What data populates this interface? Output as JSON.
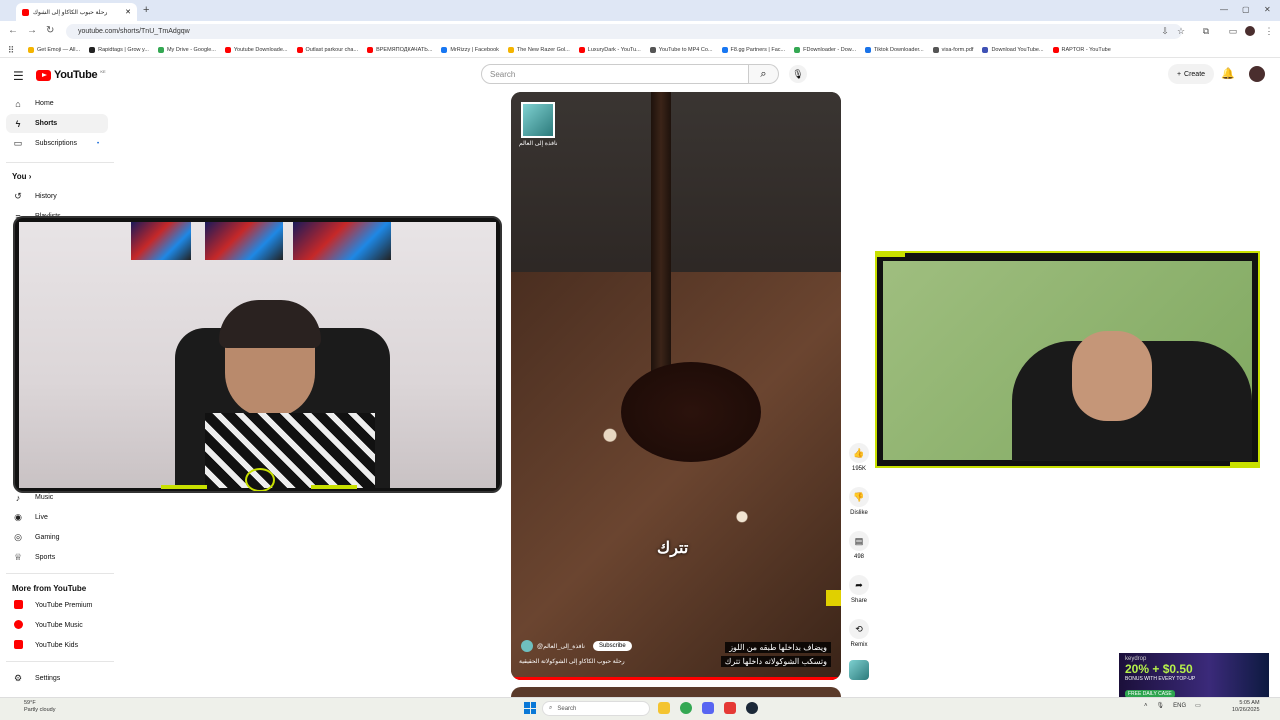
{
  "browser": {
    "tab_title": "رحلة حبوب الكاكاو إلى الشوك",
    "url": "youtube.com/shorts/TnU_TmAdgqw",
    "bookmarks": [
      {
        "label": "Get Emoji — All...",
        "color": "#f4b400"
      },
      {
        "label": "Rapidtags | Grow y...",
        "color": "#222222"
      },
      {
        "label": "My Drive - Google...",
        "color": "#34a853"
      },
      {
        "label": "Youtube Downloade...",
        "color": "#ff0000"
      },
      {
        "label": "Outlast parkour cha...",
        "color": "#ff0000"
      },
      {
        "label": "ВРЕМЯПОДКАЧАТЬ...",
        "color": "#ff0000"
      },
      {
        "label": "MrRizzy | Facebook",
        "color": "#1877f2"
      },
      {
        "label": "The New Razer Gol...",
        "color": "#f4b400"
      },
      {
        "label": "LuxuryDark - YouTu...",
        "color": "#ff0000"
      },
      {
        "label": "YouTube to MP4 Co...",
        "color": "#555555"
      },
      {
        "label": "F8.gg Partners | Fac...",
        "color": "#1877f2"
      },
      {
        "label": "FDownloader - Dow...",
        "color": "#34a853"
      },
      {
        "label": "Tiktok Downloader...",
        "color": "#1a73e8"
      },
      {
        "label": "visa-form.pdf",
        "color": "#555555"
      },
      {
        "label": "Download YouTube...",
        "color": "#3f51b5"
      },
      {
        "label": "RAPTOR - YouTube",
        "color": "#ff0000"
      }
    ]
  },
  "header": {
    "logo_text": "YouTube",
    "logo_sup": "KE",
    "search_placeholder": "Search",
    "create_label": "Create"
  },
  "sidebar": {
    "top": [
      {
        "label": "Home",
        "icon": "home-icon",
        "glyph": "⌂"
      },
      {
        "label": "Shorts",
        "icon": "shorts-icon",
        "glyph": "ϟ"
      },
      {
        "label": "Subscriptions",
        "icon": "subscriptions-icon",
        "glyph": "▭"
      }
    ],
    "you_heading": "You",
    "you_items": [
      {
        "label": "History",
        "icon": "history-icon",
        "glyph": "↺"
      },
      {
        "label": "Playlists",
        "icon": "playlists-icon",
        "glyph": "≡"
      }
    ],
    "explore_items": [
      {
        "label": "Music",
        "icon": "music-icon",
        "glyph": "♪"
      },
      {
        "label": "Live",
        "icon": "live-icon",
        "glyph": "◉"
      },
      {
        "label": "Gaming",
        "icon": "gaming-icon",
        "glyph": "◎"
      },
      {
        "label": "Sports",
        "icon": "sports-icon",
        "glyph": "♕"
      }
    ],
    "more_heading": "More from YouTube",
    "more_items": [
      {
        "label": "YouTube Premium",
        "icon": "youtube-premium-icon"
      },
      {
        "label": "YouTube Music",
        "icon": "youtube-music-icon"
      },
      {
        "label": "YouTube Kids",
        "icon": "youtube-kids-icon"
      }
    ],
    "settings_label": "Settings"
  },
  "short": {
    "corner_channel": "نافذة إلى العالم",
    "caption_word": "تترك",
    "subtitle_line1": "ويضاف بداخلها طبقه من اللوز",
    "subtitle_line2": "وتسكب الشوكولاته داخلها تترك",
    "channel_handle": "@نافذة_إلى_العالم",
    "subscribe_label": "Subscribe",
    "title": "رحلة حبوب الكاكاو إلى الشوكولاتة الحقيقية"
  },
  "actions": {
    "like_count": "195K",
    "dislike_label": "Dislike",
    "comment_count": "498",
    "share_label": "Share",
    "remix_label": "Remix"
  },
  "ad": {
    "brand": "keydrop",
    "headline": "20% + $0.50",
    "sub": "BONUS WITH EVERY TOP-UP",
    "pill": "FREE DAILY CASE"
  },
  "taskbar": {
    "weather_temp": "59°F",
    "weather_desc": "Partly cloudy",
    "search_label": "Search",
    "lang": "ENG",
    "time": "5:05 AM",
    "date": "10/26/2025"
  }
}
